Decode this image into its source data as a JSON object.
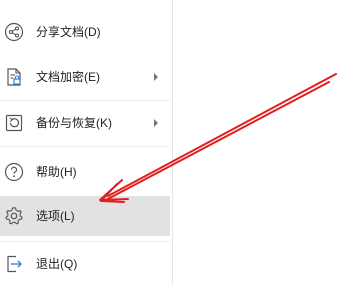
{
  "menu": {
    "items": [
      {
        "label": "分享文档(D)",
        "icon": "share-icon",
        "has_submenu": false
      },
      {
        "label": "文档加密(E)",
        "icon": "document-lock-icon",
        "has_submenu": true
      },
      {
        "label": "备份与恢复(K)",
        "icon": "backup-restore-icon",
        "has_submenu": true
      },
      {
        "label": "帮助(H)",
        "icon": "help-icon",
        "has_submenu": false
      },
      {
        "label": "选项(L)",
        "icon": "gear-icon",
        "has_submenu": false,
        "selected": true
      },
      {
        "label": "退出(Q)",
        "icon": "exit-icon",
        "has_submenu": false
      }
    ]
  },
  "annotation": {
    "arrow_color": "#e02020"
  },
  "colors": {
    "selected_bg": "#e2e2e2",
    "icon_stroke": "#555555",
    "text": "#222222"
  }
}
